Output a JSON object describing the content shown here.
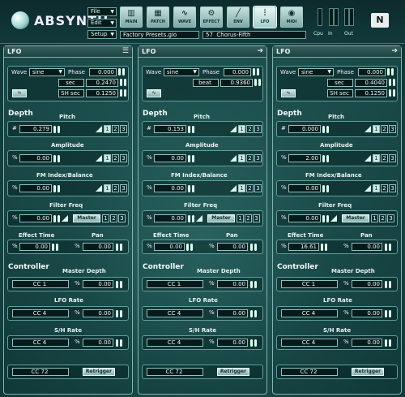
{
  "app": {
    "logo": "ABSYNTH",
    "menus": {
      "file": "File",
      "edit": "Edit",
      "setup": "Setup"
    },
    "toolbar": [
      "MAIN",
      "PATCH",
      "WAVE",
      "EFFECT",
      "ENV",
      "LFO",
      "MIDI"
    ],
    "preset_file": "Factory Presets.gio",
    "preset_num": "57",
    "preset_name": "Chorus-Fifth",
    "meters": [
      "Cpu",
      "In",
      "Out"
    ],
    "brand": "N"
  },
  "panels": [
    {
      "title": "LFO",
      "wave": "sine",
      "phase": "0.000",
      "rate": "0.2470",
      "rate_unit": "sec",
      "sh": "0.1250",
      "sh_unit": "SH sec",
      "shape_icon": "lfo-shape-icon",
      "pitch": "0.279",
      "amplitude": "0.00",
      "fm": "0.00",
      "filter": "0.00",
      "effect_time": "0.00",
      "pan": "0.00",
      "master_depth_cc": "CC 1",
      "master_depth": "0.00",
      "lfo_rate_cc": "CC 4",
      "lfo_rate": "0.00",
      "sh_rate_cc": "CC 4",
      "sh_rate": "0.00",
      "retrigger_cc": "CC 72"
    },
    {
      "title": "LFO",
      "wave": "sine",
      "phase": "0.000",
      "rate": "0.9360",
      "rate_unit": "beat",
      "sh": "",
      "sh_unit": "",
      "shape_icon": "lfo-shape-icon",
      "pitch": "0.153",
      "amplitude": "0.00",
      "fm": "0.00",
      "filter": "0.00",
      "effect_time": "0.00",
      "pan": "0.00",
      "master_depth_cc": "CC 1",
      "master_depth": "0.00",
      "lfo_rate_cc": "CC 4",
      "lfo_rate": "0.00",
      "sh_rate_cc": "CC 4",
      "sh_rate": "0.00",
      "retrigger_cc": "CC 72"
    },
    {
      "title": "LFO",
      "wave": "sine",
      "phase": "0.000",
      "rate": "0.4040",
      "rate_unit": "sec",
      "sh": "0.1250",
      "sh_unit": "SH sec",
      "shape_icon": "lfo-shape-icon",
      "pitch": "0.000",
      "amplitude": "2.00",
      "fm": "0.00",
      "filter": "0.00",
      "effect_time": "16.61",
      "pan": "0.00",
      "master_depth_cc": "CC 1",
      "master_depth": "0.00",
      "lfo_rate_cc": "CC 4",
      "lfo_rate": "0.00",
      "sh_rate_cc": "CC 4",
      "sh_rate": "0.00",
      "retrigger_cc": "CC 72"
    }
  ],
  "labels": {
    "wave": "Wave",
    "phase": "Phase",
    "depth": "Depth",
    "pitch": "Pitch",
    "amplitude": "Amplitude",
    "fm": "FM Index/Balance",
    "filter": "Filter Freq",
    "effect_time": "Effect Time",
    "pan": "Pan",
    "controller": "Controller",
    "master_depth": "Master Depth",
    "lfo_rate": "LFO Rate",
    "sh_rate": "S/H Rate",
    "retrigger": "Retrigger",
    "master": "Master",
    "hash": "#",
    "pct": "%",
    "n1": "1",
    "n2": "2",
    "n3": "3"
  }
}
